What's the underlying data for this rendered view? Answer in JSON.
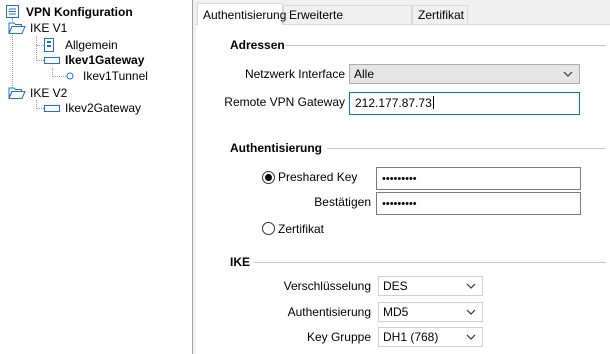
{
  "tree": {
    "root": {
      "label": "VPN Konfiguration",
      "icon": "list-icon"
    },
    "nodes": [
      {
        "label": "IKE V1",
        "icon": "folder-open-icon"
      },
      {
        "label": "Allgemein",
        "icon": "document-icon"
      },
      {
        "label": "Ikev1Gateway",
        "icon": "gateway-icon"
      },
      {
        "label": "Ikev1Tunnel",
        "icon": "tunnel-icon"
      },
      {
        "label": "IKE V2",
        "icon": "folder-open-icon"
      },
      {
        "label": "Ikev2Gateway",
        "icon": "gateway-icon"
      }
    ]
  },
  "tabs": [
    {
      "label": "Authentisierung",
      "active": true
    },
    {
      "label": "Erweiterte Einstellungen",
      "active": false
    },
    {
      "label": "Zertifikat",
      "active": false
    }
  ],
  "addresses": {
    "heading": "Adressen",
    "interface_label": "Netzwerk Interface",
    "interface_value": "Alle",
    "gateway_label": "Remote VPN Gateway",
    "gateway_value": "212.177.87.73"
  },
  "auth": {
    "heading": "Authentisierung",
    "preshared_label": "Preshared Key",
    "preshared_value": "•••••••••",
    "confirm_label": "Bestätigen",
    "confirm_value": "•••••••••",
    "certificate_label": "Zertifikat",
    "selected": "Preshared Key"
  },
  "ike": {
    "heading": "IKE",
    "encryption_label": "Verschlüsselung",
    "encryption_value": "DES",
    "authentication_label": "Authentisierung",
    "authentication_value": "MD5",
    "keygroup_label": "Key Gruppe",
    "keygroup_value": "DH1 (768)"
  },
  "colors": {
    "focus_border": "#0078d7",
    "tree_line": "#a0a0a0",
    "folder": "#1e6fd9"
  }
}
